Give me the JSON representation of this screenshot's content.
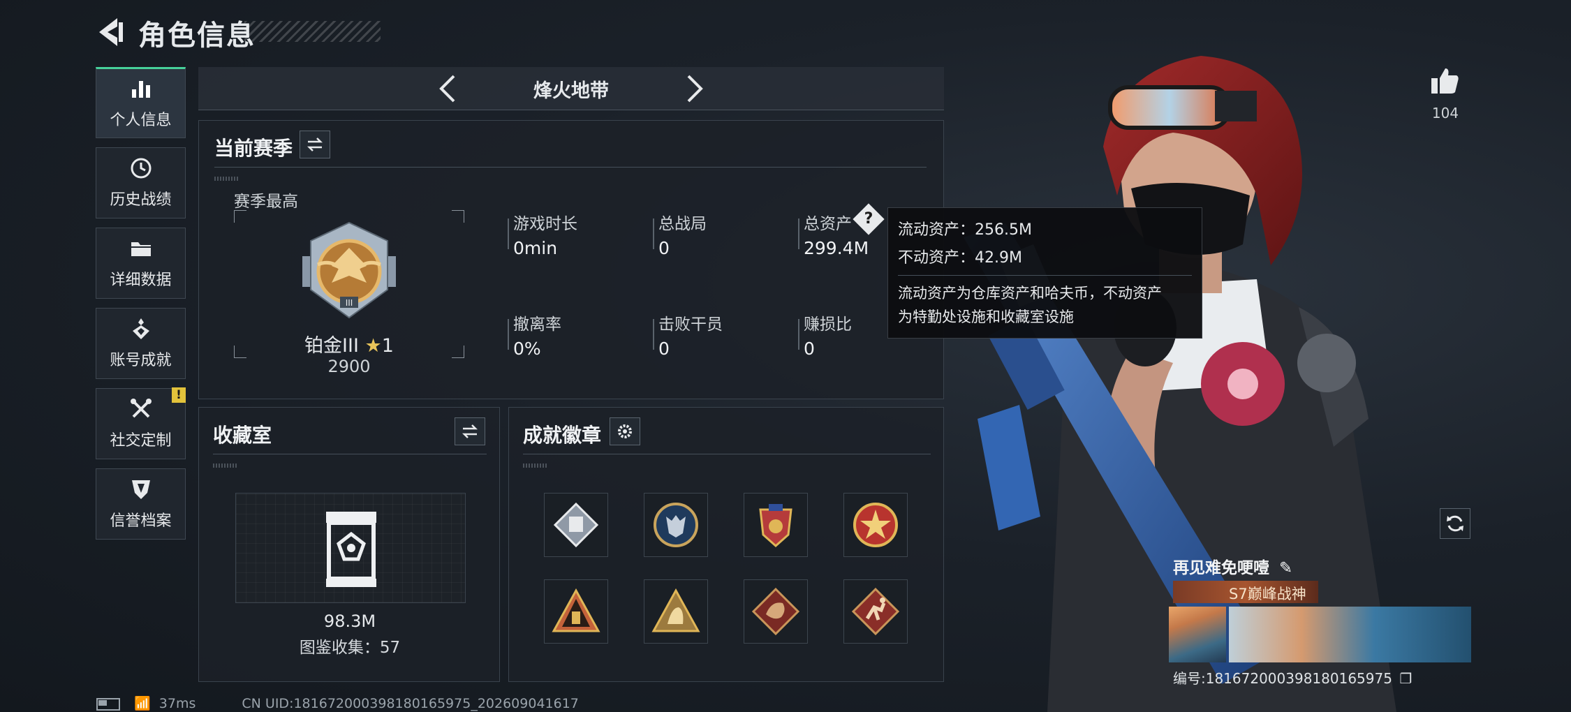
{
  "header": {
    "title": "角色信息"
  },
  "sidebar": {
    "items": [
      {
        "label": "个人信息",
        "icon": "bar-chart-icon",
        "active": true
      },
      {
        "label": "历史战绩",
        "icon": "history-clock-icon"
      },
      {
        "label": "详细数据",
        "icon": "folder-icon"
      },
      {
        "label": "账号成就",
        "icon": "medal-icon"
      },
      {
        "label": "社交定制",
        "icon": "tools-icon",
        "alert": "!"
      },
      {
        "label": "信誉档案",
        "icon": "shield-icon"
      }
    ]
  },
  "mode": {
    "title": "烽火地带"
  },
  "season": {
    "title": "当前赛季",
    "best_label": "赛季最高",
    "rank_name": "铂金III",
    "rank_stars": "1",
    "rank_score": "2900",
    "stats": [
      {
        "label": "游戏时长",
        "value": "0min"
      },
      {
        "label": "总战局",
        "value": "0"
      },
      {
        "label": "总资产",
        "value": "299.4M"
      },
      {
        "label": "撤离率",
        "value": "0%"
      },
      {
        "label": "击败干员",
        "value": "0"
      },
      {
        "label": "赚损比",
        "value": "0"
      }
    ]
  },
  "tooltip": {
    "liquid": "流动资产：256.5M",
    "fixed": "不动资产：42.9M",
    "desc_line1": "流动资产为仓库资产和哈夫币，不动资产",
    "desc_line2": "为特勤处设施和收藏室设施"
  },
  "collection": {
    "title": "收藏室",
    "value": "98.3M",
    "count": "图鉴收集：57"
  },
  "achievements": {
    "title": "成就徽章",
    "badges": [
      "badge-diamond-fist",
      "badge-wolf",
      "badge-shield-stars",
      "badge-red-star",
      "badge-pyramid",
      "badge-sphinx",
      "badge-dragon",
      "badge-runner"
    ]
  },
  "profile": {
    "likes": "104",
    "nickname": "再见难免哽噎",
    "title_plate": "S7巅峰战神",
    "uid_label": "编号:18167200039818016597​5"
  },
  "status": {
    "ping": "37ms",
    "uid": "CN UID:18167200039818016597​5_202609041617"
  },
  "colors": {
    "accent": "#46d19a",
    "alert": "#e2c23b",
    "panel_bg": "#1c2128"
  }
}
